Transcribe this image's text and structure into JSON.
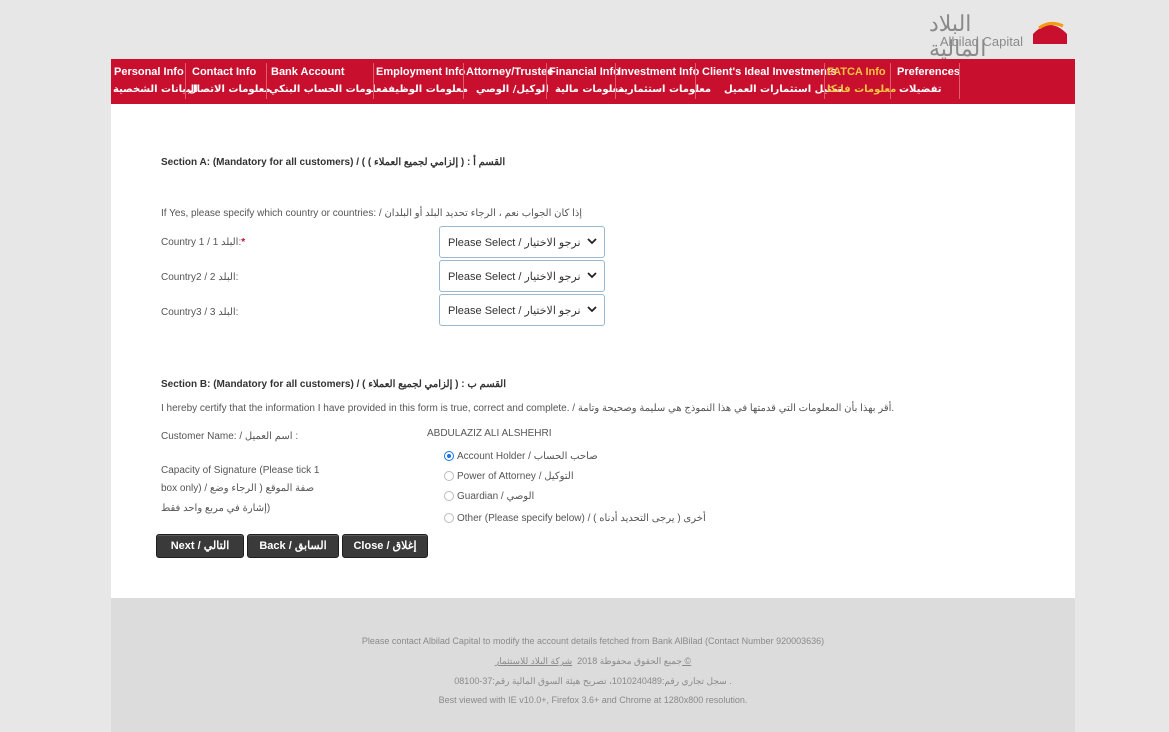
{
  "brand": {
    "name_ar": "البلاد المالية",
    "name_en": "Albilad Capital",
    "colors": {
      "primary": "#c8102e",
      "accent_active": "#f6c343"
    }
  },
  "nav": {
    "items": [
      {
        "en": "Personal Info",
        "ar": "البيانات الشخصية",
        "active": false
      },
      {
        "en": "Contact Info",
        "ar": "معلومات الاتصال",
        "active": false
      },
      {
        "en": "Bank Account",
        "ar": "معلومات الحساب البنكي",
        "active": false
      },
      {
        "en": "Employment Info",
        "ar": "معلومات الوظيفة",
        "active": false
      },
      {
        "en": "Attorney/Trustee",
        "ar": "الوكيل/ الوصي",
        "active": false
      },
      {
        "en": "Financial Info",
        "ar": "معلومات مالية",
        "active": false
      },
      {
        "en": "Investment Info",
        "ar": "معلومات استثمارية",
        "active": false
      },
      {
        "en": "Client's Ideal Investments",
        "ar": "تمثيل استثمارات العميل",
        "active": false
      },
      {
        "en": "FATCA Info",
        "ar": "معلومات فاتكا",
        "active": true
      },
      {
        "en": "Preferences",
        "ar": "تفضيلات",
        "active": false
      }
    ]
  },
  "section_a": {
    "title_en": "Section A: (Mandatory for all customers) / (",
    "title_ar": "القسم أ : ( إلزامي لجميع العملاء )",
    "title_en_tail": ") /",
    "instruction": "If Yes, please specify which country or countries: / إذا كان الجواب نعم ، الرجاء تحديد البلد أو البلدان",
    "countries": [
      {
        "label": "Country 1 / 1 البلد:",
        "required": "*",
        "value": "Please Select / نرجو الاختيار"
      },
      {
        "label": "Country2 / 2 البلد:",
        "required": "",
        "value": "Please Select / نرجو الاختيار"
      },
      {
        "label": "Country3 / 3 البلد:",
        "required": "",
        "value": "Please Select / نرجو الاختيار"
      }
    ]
  },
  "section_b": {
    "title": "Section B: (Mandatory for all customers) / ( إلزامي لجميع العملاء ) : القسم ب",
    "certify": "I hereby certify that the information I have provided in this form is true, correct and complete. / أقر بهذا بأن المعلومات التي قدمتها في هذا النموذج هي سليمة وصحيحة وتامة.",
    "customer_name_label": "Customer Name: / اسم العميل :",
    "customer_name_value": "ABDULAZIZ ALI ALSHEHRI",
    "capacity_label_1": "Capacity of Signature (Please tick 1",
    "capacity_label_2": "box only) / صفة الموقع ( الرجاء وضع",
    "capacity_label_3": "إشارة في مربع واحد فقط)",
    "options": [
      {
        "label": "Account Holder / صاحب الحساب",
        "checked": true
      },
      {
        "label": "Power of Attorney / التوكيل",
        "checked": false
      },
      {
        "label": "Guardian / الوصي",
        "checked": false
      },
      {
        "label": "Other (Please specify below) / أخرى ( يرجى التحديد أدناه )",
        "checked": false
      }
    ]
  },
  "buttons": {
    "next": "Next / التالي",
    "back": "Back / السابق",
    "close": "Close / إغلاق"
  },
  "footer": {
    "line1": "Please contact Albilad Capital to modify the account details fetched from Bank AlBilad (Contact Number 920003636)",
    "line2_prefix": "جميع الحقوق محفوظة 2018",
    "line2_link": "شركة البلاد للاستثمار ©",
    "line3": "سجل تجاري رقم:1010240489، تصريح هيئة السوق المالية رقم:37-08100 .",
    "line4": "Best viewed with IE v10.0+, Firefox 3.6+ and Chrome at 1280x800 resolution."
  }
}
